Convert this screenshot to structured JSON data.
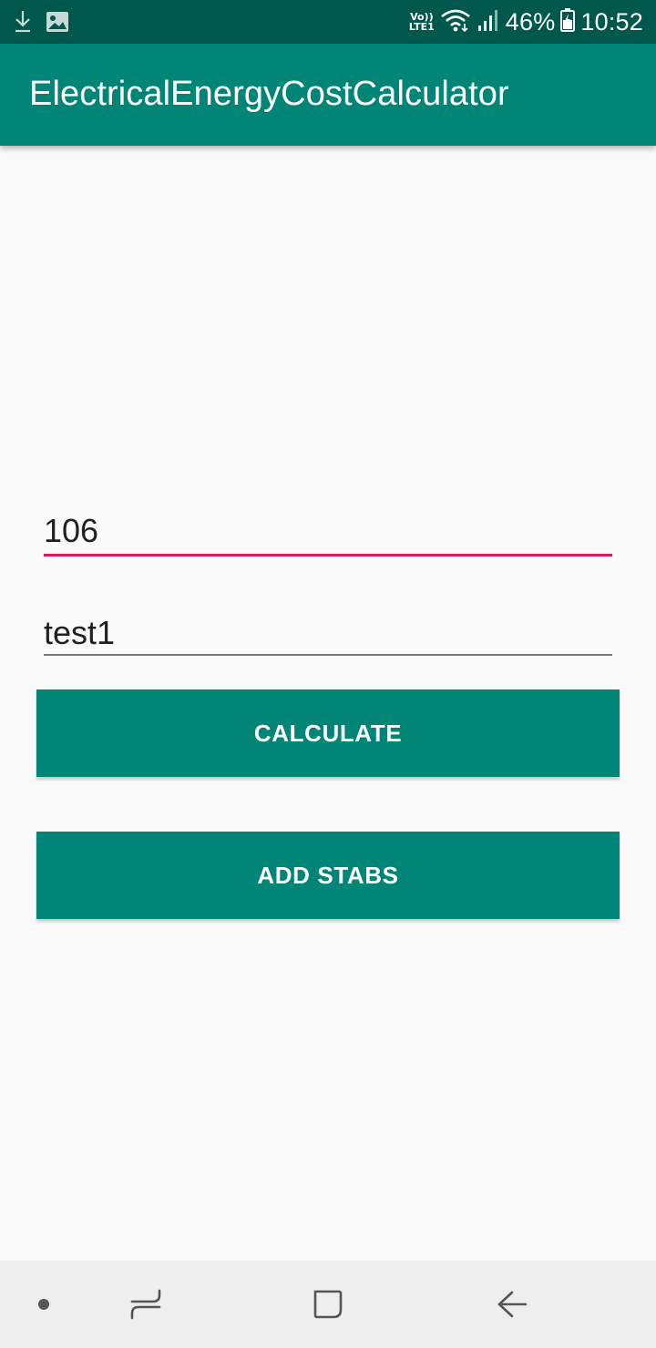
{
  "status_bar": {
    "left_icons": [
      "download-icon",
      "image-icon"
    ],
    "network_label_top": "Vo))",
    "network_label_bottom": "LTE1",
    "battery_percent": "46%",
    "time": "10:52"
  },
  "app_bar": {
    "title": "ElectricalEnergyCostCalculator"
  },
  "form": {
    "field1_value": "106",
    "field2_value": "test1",
    "calculate_label": "CALCULATE",
    "add_stabs_label": "ADD STABS"
  },
  "colors": {
    "primary": "#008577",
    "primary_dark": "#00574b",
    "accent": "#d81b60",
    "background": "#fafafa",
    "nav_bar": "#eeeeee"
  },
  "nav_bar": {
    "items": [
      "dot-indicator-icon",
      "recent-apps-icon",
      "home-icon",
      "back-icon"
    ]
  }
}
